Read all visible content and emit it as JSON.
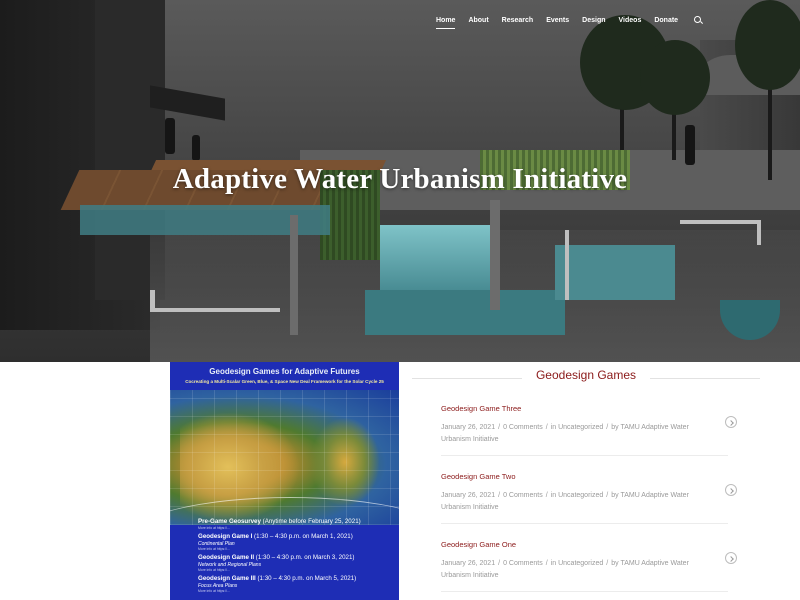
{
  "nav": {
    "items": [
      "Home",
      "About",
      "Research",
      "Events",
      "Design",
      "Videos",
      "Donate"
    ],
    "active_index": 0,
    "search_icon": "search-icon"
  },
  "hero": {
    "title": "Adaptive Water Urbanism Initiative"
  },
  "poster": {
    "title": "Geodesign Games for Adaptive Futures",
    "subtitle": "Cocreating a Multi-Scalar Green, Blue, & Space New Deal Framework for the Solar Cycle 25",
    "items": [
      {
        "main_bold": "Pre-Game Geosurvey",
        "main_rest": " (Anytime before February 25, 2021)",
        "sub": "",
        "link": "More info at https://..."
      },
      {
        "main_bold": "Geodesign Game I",
        "main_rest": " (1:30 – 4:30 p.m. on March 1, 2021)",
        "sub": "Continental Plan",
        "link": "More info at https://..."
      },
      {
        "main_bold": "Geodesign Game II",
        "main_rest": " (1:30 – 4:30 p.m. on March 3, 2021)",
        "sub": "Network and Regional Plans",
        "link": "More info at https://..."
      },
      {
        "main_bold": "Geodesign Game III",
        "main_rest": " (1:30 – 4:30 p.m. on March 5, 2021)",
        "sub": "Focus Area Plans",
        "link": "More info at https://..."
      }
    ]
  },
  "section": {
    "title": "Geodesign Games"
  },
  "posts": [
    {
      "title": "Geodesign Game Three",
      "date": "January 26, 2021",
      "comments": "0 Comments",
      "in_label": "in",
      "category": "Uncategorized",
      "by_label": "by",
      "author": "TAMU Adaptive Water Urbanism Initiative"
    },
    {
      "title": "Geodesign Game Two",
      "date": "January 26, 2021",
      "comments": "0 Comments",
      "in_label": "in",
      "category": "Uncategorized",
      "by_label": "by",
      "author": "TAMU Adaptive Water Urbanism Initiative"
    },
    {
      "title": "Geodesign Game One",
      "date": "January 26, 2021",
      "comments": "0 Comments",
      "in_label": "in",
      "category": "Uncategorized",
      "by_label": "by",
      "author": "TAMU Adaptive Water Urbanism Initiative"
    }
  ],
  "colors": {
    "accent": "#8b1a1a",
    "meta": "#9a9a9a",
    "poster_bg": "#1e2db5"
  }
}
